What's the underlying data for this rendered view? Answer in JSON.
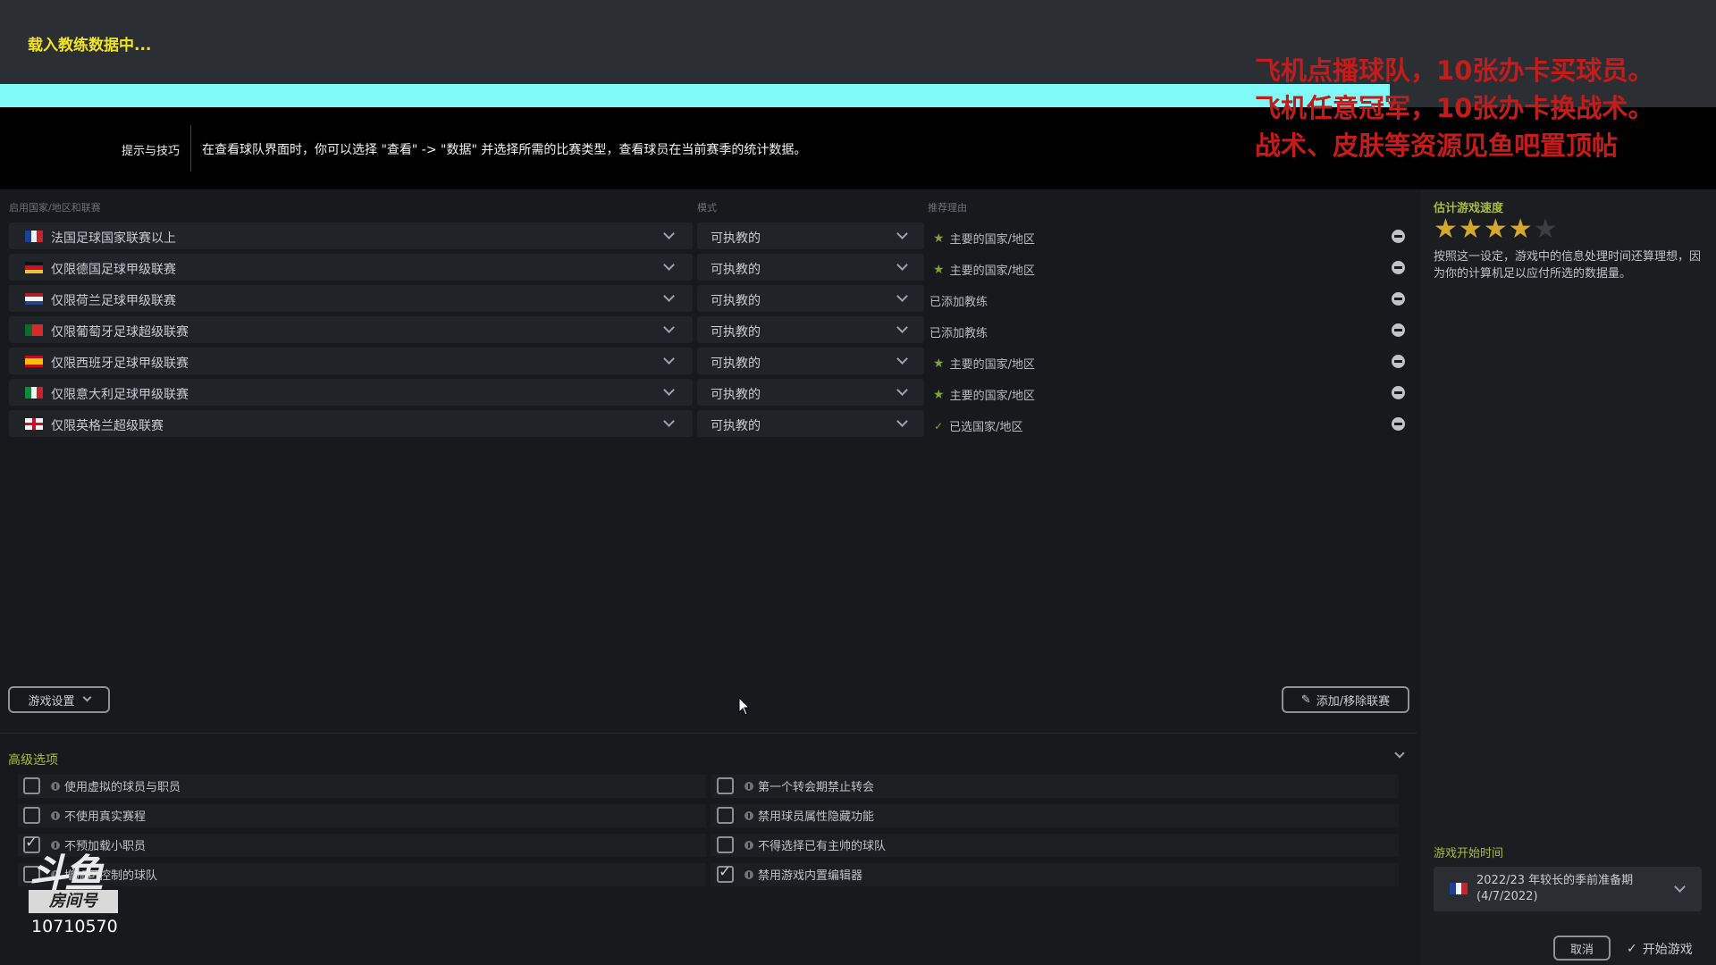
{
  "loading": {
    "text": "载入教练数据中...",
    "progress": 0.81
  },
  "tips": {
    "label": "提示与技巧",
    "text": "在查看球队界面时，你可以选择 \"查看\" -> \"数据\" 并选择所需的比赛类型，查看球员在当前赛季的统计数据。"
  },
  "overlay": {
    "lines": [
      "飞机点播球队，10张办卡买球员。",
      "飞机任意冠军，10张办卡换战术。",
      "战术、皮肤等资源见鱼吧置顶帖"
    ]
  },
  "table": {
    "headers": {
      "league": "启用国家/地区和联赛",
      "mode": "模式",
      "reason": "推荐理由"
    },
    "rows": [
      {
        "flag": "fr",
        "league": "法国足球国家联赛以上",
        "mode": "可执教的",
        "reason_icon": "star",
        "reason": "主要的国家/地区"
      },
      {
        "flag": "de",
        "league": "仅限德国足球甲级联赛",
        "mode": "可执教的",
        "reason_icon": "star",
        "reason": "主要的国家/地区"
      },
      {
        "flag": "nl",
        "league": "仅限荷兰足球甲级联赛",
        "mode": "可执教的",
        "reason_icon": "none",
        "reason": "已添加教练"
      },
      {
        "flag": "pt",
        "league": "仅限葡萄牙足球超级联赛",
        "mode": "可执教的",
        "reason_icon": "none",
        "reason": "已添加教练"
      },
      {
        "flag": "es",
        "league": "仅限西班牙足球甲级联赛",
        "mode": "可执教的",
        "reason_icon": "star",
        "reason": "主要的国家/地区"
      },
      {
        "flag": "it",
        "league": "仅限意大利足球甲级联赛",
        "mode": "可执教的",
        "reason_icon": "star",
        "reason": "主要的国家/地区"
      },
      {
        "flag": "en",
        "league": "仅限英格兰超级联赛",
        "mode": "可执教的",
        "reason_icon": "check",
        "reason": "已选国家/地区"
      }
    ]
  },
  "buttons": {
    "game_settings": "游戏设置",
    "add_remove": "添加/移除联赛",
    "cancel": "取消",
    "start_game": "开始游戏"
  },
  "advanced": {
    "title": "高级选项",
    "left": [
      {
        "label": "使用虚拟的球员与职员",
        "checked": false
      },
      {
        "label": "不使用真实赛程",
        "checked": false
      },
      {
        "label": "不预加载小职员",
        "checked": true
      },
      {
        "label": "增加可控制的球队",
        "checked": false
      }
    ],
    "right": [
      {
        "label": "第一个转会期禁止转会",
        "checked": false
      },
      {
        "label": "禁用球员属性隐藏功能",
        "checked": false
      },
      {
        "label": "不得选择已有主帅的球队",
        "checked": false
      },
      {
        "label": "禁用游戏内置编辑器",
        "checked": true
      }
    ]
  },
  "right_panel": {
    "speed_title": "估计游戏速度",
    "rating": 4,
    "rating_max": 5,
    "speed_desc": "按照这一设定，游戏中的信息处理时间还算理想，因为你的计算机足以应付所选的数据量。",
    "start_title": "游戏开始时间",
    "start_value_line1": "2022/23 年较长的季前准备期",
    "start_value_line2": "(4/7/2022)"
  },
  "watermark": {
    "logo": "斗鱼",
    "room_label": "房间号",
    "room_id": "10710570"
  },
  "colors": {
    "accent": "#a6bc3d",
    "progress": "#7ffaf6",
    "loading_text": "#f2e41c",
    "overlay_text": "#c41b1b",
    "star_on": "#d6a82a",
    "star_off": "#3a3d42"
  }
}
